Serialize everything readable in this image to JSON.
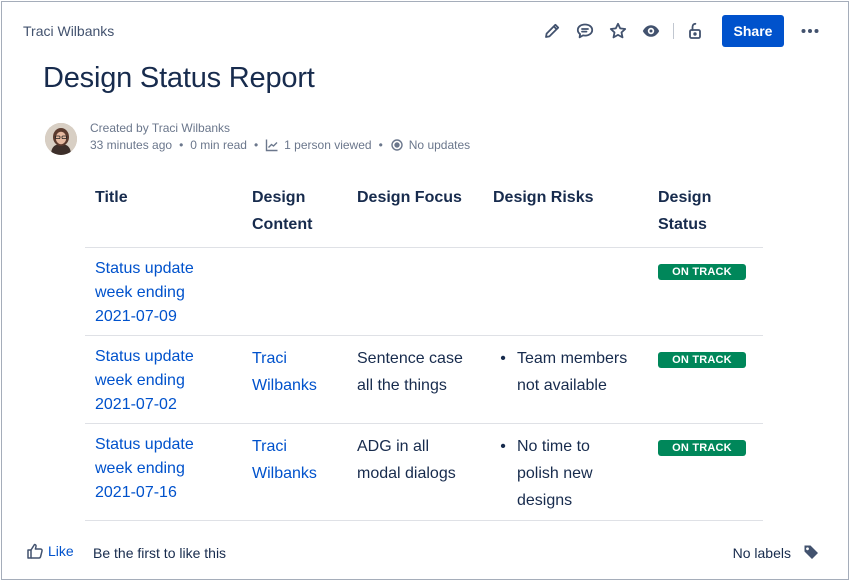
{
  "breadcrumb": {
    "author": "Traci Wilbanks"
  },
  "toolbar": {
    "share_label": "Share",
    "icons": [
      "pencil-icon",
      "comment-icon",
      "star-icon",
      "eye-icon",
      "unlock-icon",
      "more-icon"
    ]
  },
  "page": {
    "title": "Design Status Report"
  },
  "byline": {
    "created_by": "Created by Traci Wilbanks",
    "time_ago": "33 minutes ago",
    "read_time": "0 min read",
    "views": "1 person viewed",
    "updates": "No updates"
  },
  "table": {
    "headers": {
      "title": "Title",
      "content": [
        "Design",
        "Content"
      ],
      "focus": "Design Focus",
      "risks": "Design Risks",
      "status": [
        "Design",
        "Status"
      ]
    },
    "rows": [
      {
        "title": [
          "Status update",
          "week ending",
          "2021-07-09"
        ],
        "content": [],
        "focus": [],
        "risks": [],
        "status": "ON TRACK"
      },
      {
        "title": [
          "Status update",
          "week ending",
          "2021-07-02"
        ],
        "content": [
          "Traci",
          "Wilbanks"
        ],
        "focus": [
          "Sentence case",
          "all the things"
        ],
        "risks": [
          "Team members",
          "not available"
        ],
        "status": "ON TRACK"
      },
      {
        "title": [
          "Status update",
          "week ending",
          "2021-07-16"
        ],
        "content": [
          "Traci",
          "Wilbanks"
        ],
        "focus": [
          "ADG in all",
          "modal dialogs"
        ],
        "risks": [
          "No time to",
          "polish new",
          "designs"
        ],
        "status": "ON TRACK"
      }
    ]
  },
  "footer": {
    "like_label": "Like",
    "like_prompt": "Be the first to like this",
    "labels_text": "No labels"
  },
  "colors": {
    "primary": "#0052cc",
    "lozenge_green": "#00875a",
    "text": "#172b4d",
    "subtle": "#6b778c"
  }
}
